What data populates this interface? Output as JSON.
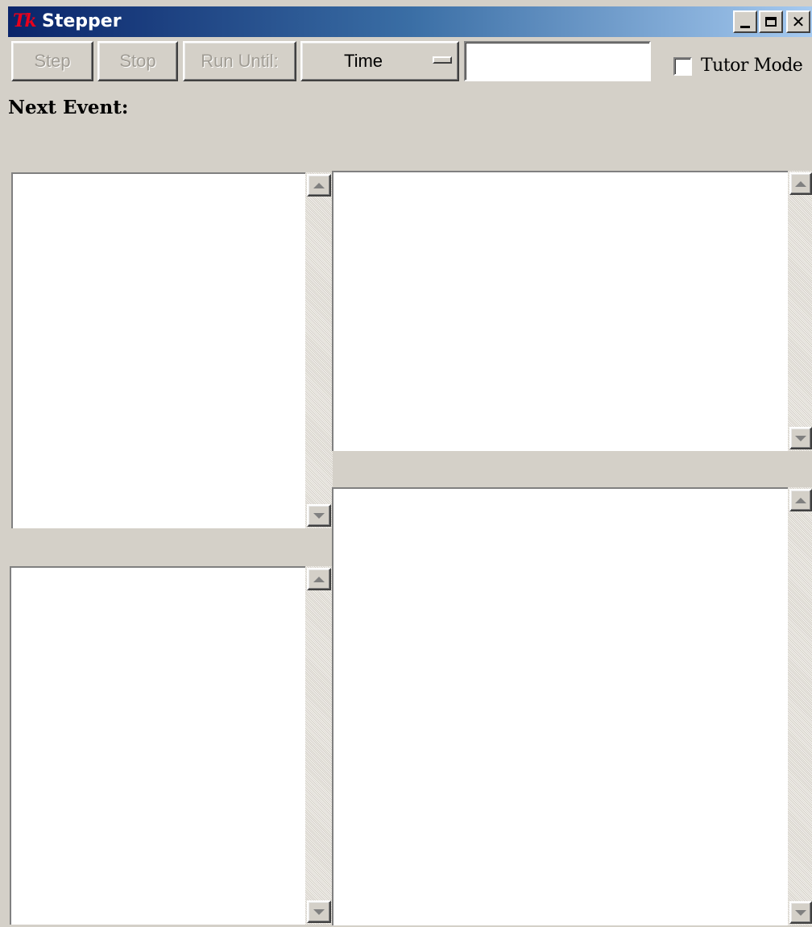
{
  "window": {
    "title": "Stepper",
    "icon": "tk-logo",
    "logo_text": "Tk",
    "controls": [
      "minimize-icon",
      "maximize-icon",
      "close-icon"
    ]
  },
  "toolbar": {
    "step_label": "Step",
    "stop_label": "Stop",
    "run_until_label": "Run Until:",
    "mode_menu_value": "Time",
    "run_until_value": "",
    "tutor_mode_label": "Tutor Mode",
    "tutor_mode_checked": false
  },
  "status": {
    "next_event_label": "Next Event:"
  },
  "panes": {
    "top_left": {
      "content": ""
    },
    "bottom_left": {
      "content": ""
    },
    "top_right": {
      "content": ""
    },
    "bottom_right": {
      "content": ""
    }
  },
  "colors": {
    "title_gradient_start": "#0a246a",
    "title_gradient_end": "#a6caf0",
    "face": "#d4d0c8",
    "disabled_text": "#a09c94",
    "logo": "#e8001c"
  }
}
